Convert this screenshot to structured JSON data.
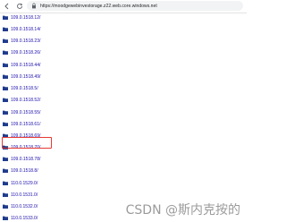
{
  "browser": {
    "url": "https://moodgewebinvestorage.z22.web.core.windows.net",
    "icons": [
      "back-icon",
      "refresh-icon",
      "lock-icon"
    ]
  },
  "directory": {
    "items": [
      {
        "label": "109.0.1518.12/"
      },
      {
        "label": "109.0.1518.14/"
      },
      {
        "label": "109.0.1518.23/"
      },
      {
        "label": "109.0.1518.26/"
      },
      {
        "label": "109.0.1518.44/"
      },
      {
        "label": "109.0.1518.49/"
      },
      {
        "label": "109.0.1518.5/"
      },
      {
        "label": "109.0.1518.52/"
      },
      {
        "label": "109.0.1518.55/"
      },
      {
        "label": "109.0.1518.61/"
      },
      {
        "label": "109.0.1518.69/"
      },
      {
        "label": "109.0.1518.70/"
      },
      {
        "label": "109.0.1518.78/",
        "highlighted": true
      },
      {
        "label": "109.0.1518.8/"
      },
      {
        "label": "110.0.1529.0/"
      },
      {
        "label": "110.0.1531.0/"
      },
      {
        "label": "110.0.1532.0/"
      },
      {
        "label": "110.0.1533.0/"
      }
    ]
  },
  "colors": {
    "link": "#1a0dab",
    "folder": "#1f3b8c",
    "highlight_border": "#e53935"
  },
  "watermark": {
    "text": "CSDN @斯内克按的"
  }
}
